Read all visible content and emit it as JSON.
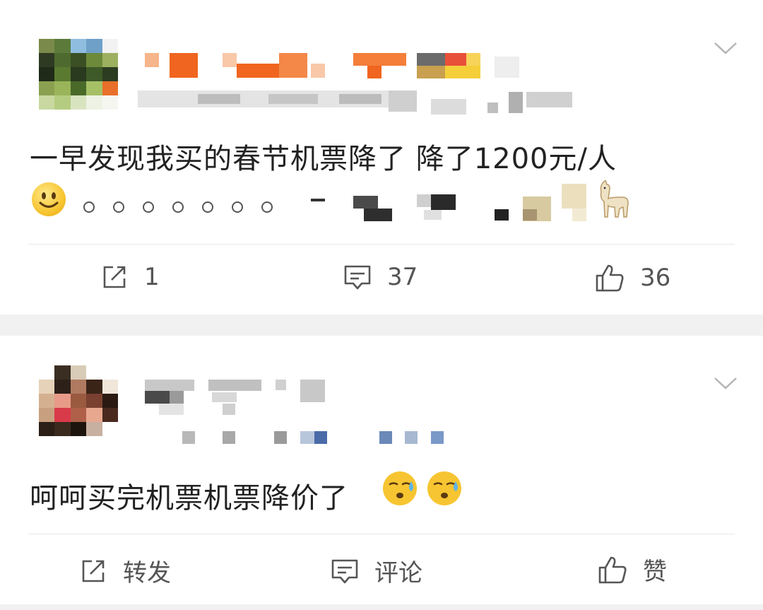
{
  "posts": [
    {
      "content": "一早发现我买的春节机票降了 降了1200元/人",
      "stats": {
        "repost": "1",
        "comment": "37",
        "like": "36"
      }
    },
    {
      "content": "呵呵买完机票机票降价了",
      "actions": {
        "repost": "转发",
        "comment": "评论",
        "like": "赞"
      }
    }
  ],
  "icons": {
    "repost": "share-icon",
    "comment": "comment-icon",
    "like": "thumbs-up-icon",
    "menu": "chevron-down-icon",
    "emoji_smile": "smile-emoji-icon",
    "emoji_sweat": "sweat-emoji-icon",
    "emoji_alpaca": "alpaca-emoji-icon"
  },
  "colors": {
    "background": "#ffffff",
    "separator": "#f1f1f1",
    "text": "#222222",
    "action_text": "#555555"
  }
}
